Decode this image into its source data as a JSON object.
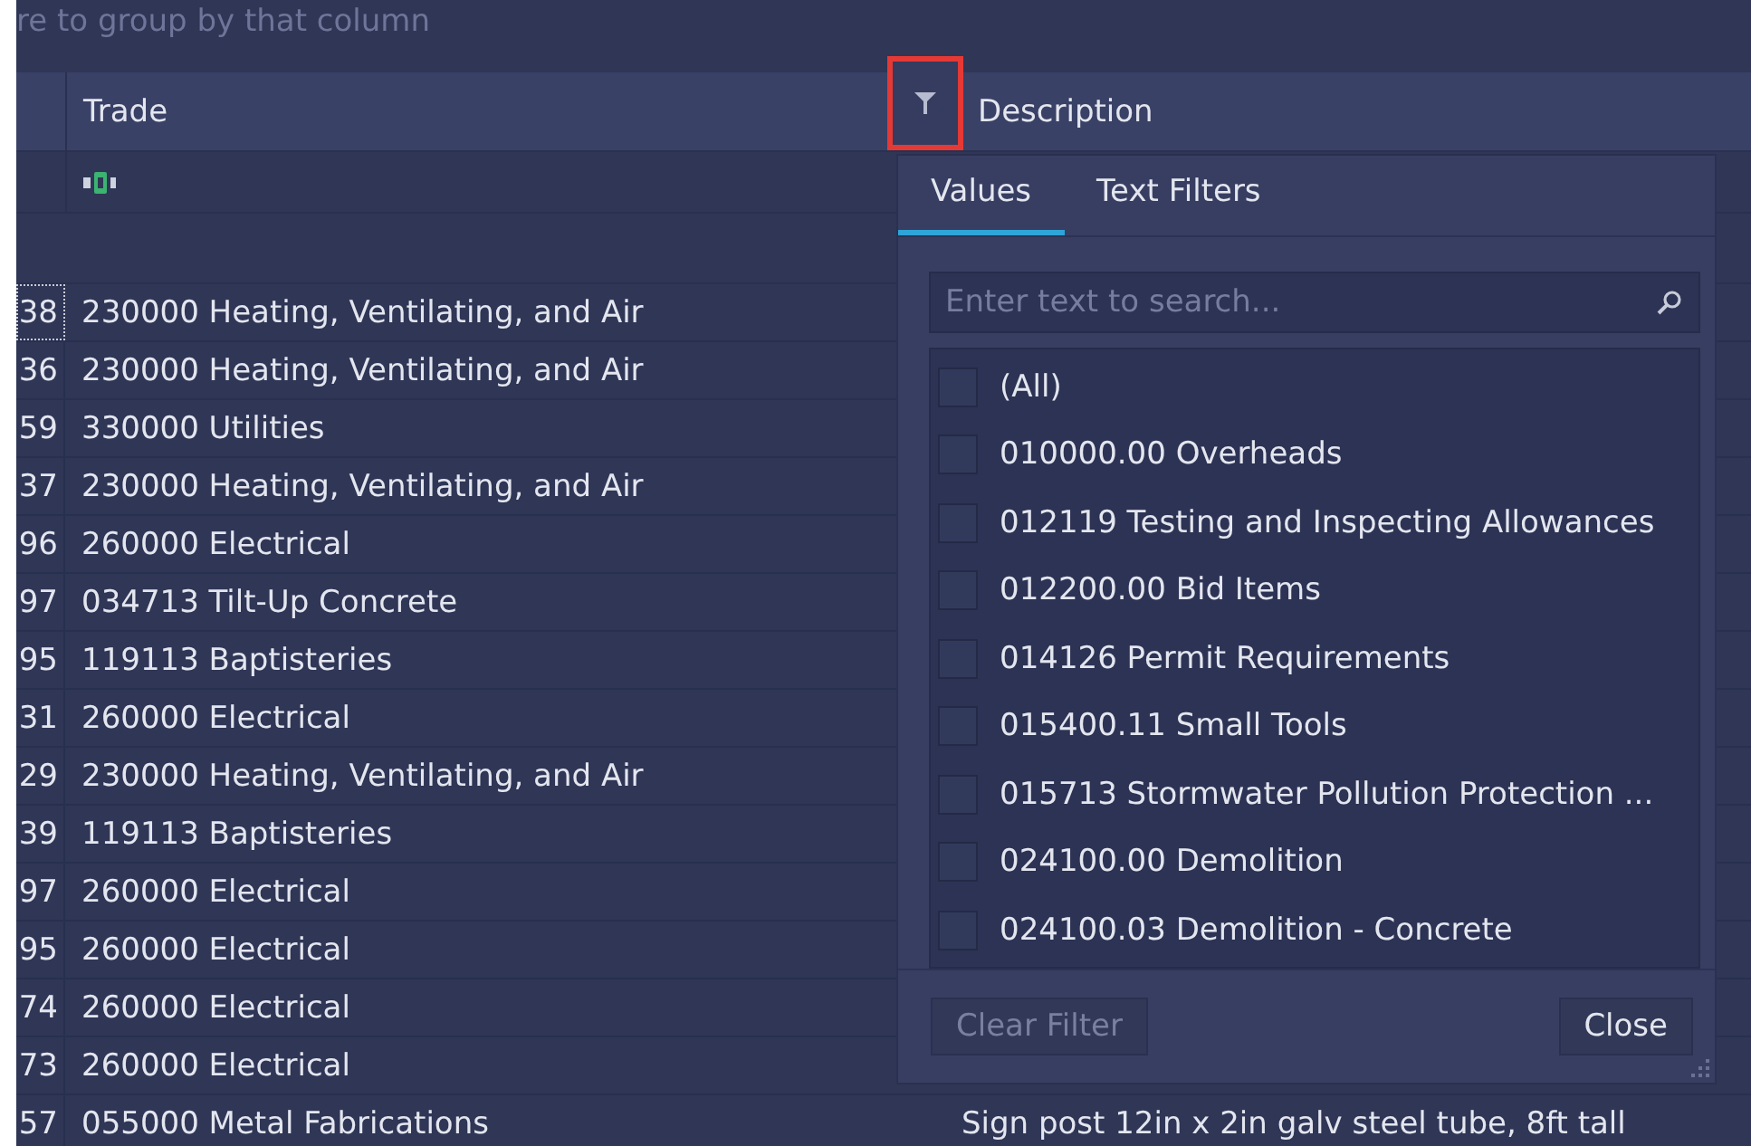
{
  "group_panel": {
    "hint": "re to group by that column"
  },
  "columns": [
    {
      "label": "Trade"
    },
    {
      "label": "Description"
    }
  ],
  "filter_button": {
    "highlighted": true
  },
  "rows": [
    {
      "id": "38",
      "trade": "230000 Heating, Ventilating, and Air",
      "focused": true
    },
    {
      "id": "36",
      "trade": "230000 Heating, Ventilating, and Air",
      "focused": false
    },
    {
      "id": "59",
      "trade": "330000 Utilities",
      "focused": false
    },
    {
      "id": "37",
      "trade": "230000 Heating, Ventilating, and Air",
      "focused": false
    },
    {
      "id": "96",
      "trade": "260000 Electrical",
      "focused": false
    },
    {
      "id": "97",
      "trade": "034713 Tilt-Up Concrete",
      "focused": false
    },
    {
      "id": "95",
      "trade": "119113 Baptisteries",
      "focused": false
    },
    {
      "id": "31",
      "trade": "260000 Electrical",
      "focused": false
    },
    {
      "id": "29",
      "trade": "230000 Heating, Ventilating, and Air",
      "focused": false
    },
    {
      "id": "39",
      "trade": "119113 Baptisteries",
      "focused": false
    },
    {
      "id": "97",
      "trade": "260000 Electrical",
      "focused": false
    },
    {
      "id": "95",
      "trade": "260000 Electrical",
      "focused": false
    },
    {
      "id": "74",
      "trade": "260000 Electrical",
      "focused": false
    },
    {
      "id": "73",
      "trade": "260000 Electrical",
      "focused": false
    },
    {
      "id": "57",
      "trade": "055000 Metal Fabrications",
      "description": "Sign post 12in x 2in galv steel tube, 8ft tall",
      "focused": false
    }
  ],
  "filter_popup": {
    "tabs": [
      {
        "label": "Values",
        "selected": true
      },
      {
        "label": "Text Filters",
        "selected": false
      }
    ],
    "search": {
      "placeholder": "Enter text to search..."
    },
    "values": [
      {
        "label": "(All)",
        "checked": false
      },
      {
        "label": "010000.00 Overheads",
        "checked": false
      },
      {
        "label": "012119 Testing and Inspecting Allowances",
        "checked": false
      },
      {
        "label": "012200.00 Bid Items",
        "checked": false
      },
      {
        "label": "014126 Permit Requirements",
        "checked": false
      },
      {
        "label": "015400.11 Small Tools",
        "checked": false
      },
      {
        "label": "015713 Stormwater Pollution Protection ...",
        "checked": false
      },
      {
        "label": "024100.00 Demolition",
        "checked": false
      },
      {
        "label": "024100.03 Demolition - Concrete",
        "checked": false
      }
    ],
    "buttons": [
      {
        "label": "Clear Filter",
        "disabled": true
      },
      {
        "label": "Close",
        "disabled": false
      }
    ]
  }
}
